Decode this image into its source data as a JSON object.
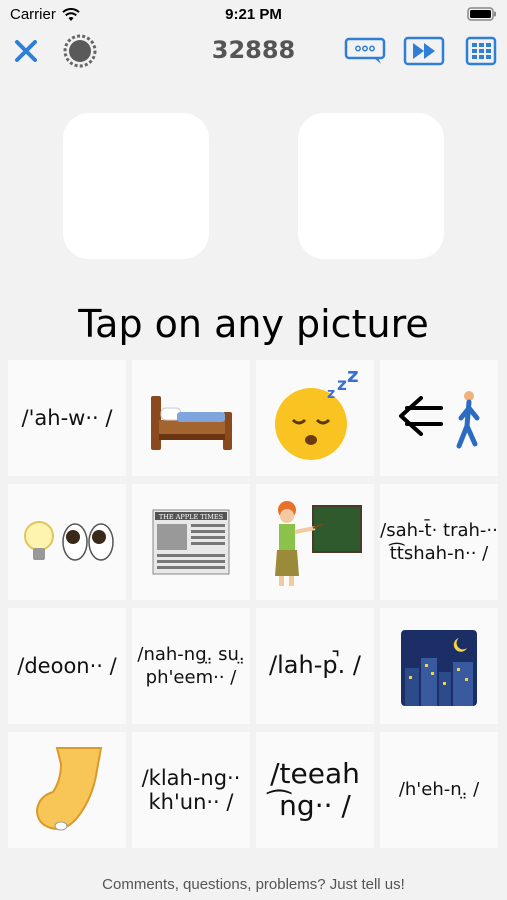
{
  "status": {
    "carrier": "Carrier",
    "time": "9:21 PM"
  },
  "toolbar": {
    "score": "32888",
    "icons": [
      "close-icon",
      "settings-gear-icon",
      "speech-bubble-icon",
      "fast-forward-icon",
      "grid-icon"
    ],
    "accent": "#2f7fd6"
  },
  "prompt": "Tap on any picture",
  "grid": {
    "cells": [
      {
        "kind": "text",
        "text": "/'ah-w·· /"
      },
      {
        "kind": "icon",
        "icon": "bed-icon"
      },
      {
        "kind": "icon",
        "icon": "sleeping-face-icon"
      },
      {
        "kind": "icon",
        "icon": "arrow-left-walking-person-icon"
      },
      {
        "kind": "icon",
        "icon": "light-bulb-eyes-icon"
      },
      {
        "kind": "icon",
        "icon": "newspaper-icon",
        "caption": "THE APPLE TIMES"
      },
      {
        "kind": "icon",
        "icon": "teacher-blackboard-icon"
      },
      {
        "kind": "text",
        "text": "/sah-t̄· trah-·· t͡tshah-n·· /"
      },
      {
        "kind": "text",
        "text": "/deoon·· /"
      },
      {
        "kind": "text",
        "text": "/nah-ng.̤ su.̤ ph'eem·· /"
      },
      {
        "kind": "text",
        "text": "/lah-p̚. /"
      },
      {
        "kind": "icon",
        "icon": "night-city-icon"
      },
      {
        "kind": "icon",
        "icon": "pinching-hand-icon"
      },
      {
        "kind": "text",
        "text": "/klah-ng·· kh'un·· /"
      },
      {
        "kind": "text",
        "text": "/teeah ͡ng·· /"
      },
      {
        "kind": "text",
        "text": "/h'eh-n.̤ /"
      }
    ]
  },
  "footer": "Comments, questions, problems? Just tell us!"
}
